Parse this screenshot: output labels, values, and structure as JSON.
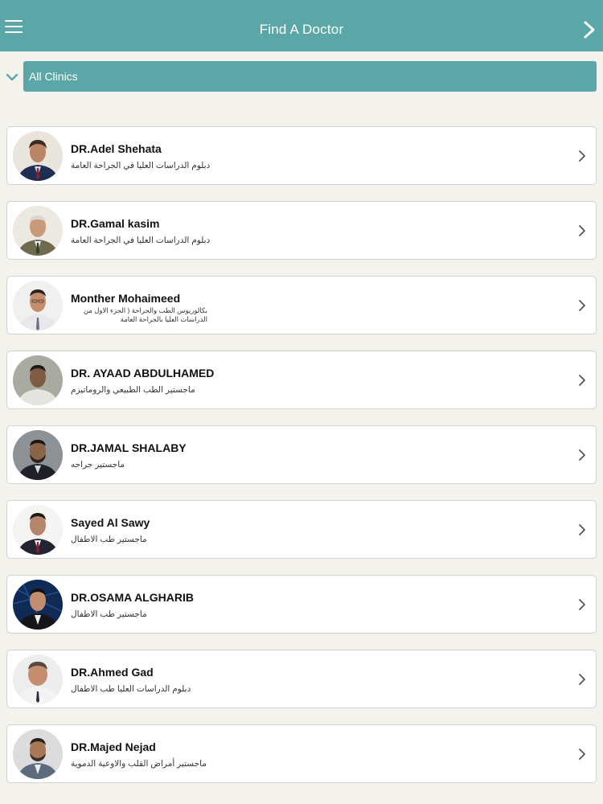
{
  "app": {
    "title": "Find A Doctor"
  },
  "header": {
    "menu_icon": "hamburger-menu-icon",
    "next_icon": "chevron-right-icon"
  },
  "filter": {
    "toggle_icon": "chevron-down-icon",
    "selected_clinic": "All Clinics"
  },
  "colors": {
    "accent": "#5ba7a8",
    "background": "#f4f2ec",
    "card": "#ffffff"
  },
  "doctors": [
    {
      "name": "DR.Adel Shehata",
      "specialty": "دبلوم الدراسات العليا في الجراحة العامة"
    },
    {
      "name": "DR.Gamal kasim",
      "specialty": "دبلوم الدراسات العليا في الجراحة العامة"
    },
    {
      "name": "Monther Mohaimeed",
      "specialty": "بكالوريوس الطب والجراحة ( الجزء الاول من\nالدراسات العليا بالجراحة العامة"
    },
    {
      "name": "DR. AYAAD ABDULHAMED",
      "specialty": "ماجستير الطب الطبيعي والروماتيزم"
    },
    {
      "name": "DR.JAMAL SHALABY",
      "specialty": "ماجستير جراحه"
    },
    {
      "name": "Sayed Al Sawy",
      "specialty": "ماجستير طب الاطفال"
    },
    {
      "name": "DR.OSAMA ALGHARIB",
      "specialty": "ماجستير طب الاطفال"
    },
    {
      "name": "DR.Ahmed Gad",
      "specialty": "دبلوم الدراسات العليا طب الاطفال"
    },
    {
      "name": "DR.Majed Nejad",
      "specialty": "ماجستير أمراض القلب والاوعية الدموية"
    }
  ]
}
